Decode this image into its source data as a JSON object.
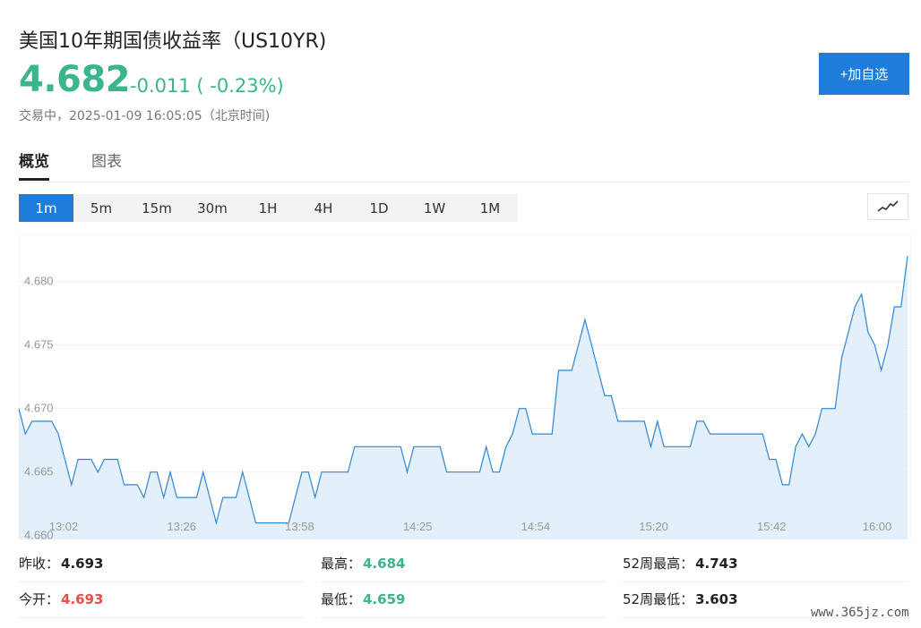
{
  "header": {
    "title": "美国10年期国债收益率（US10YR)",
    "price": "4.682",
    "change": "-0.011 ( -0.23%)",
    "status": "交易中，2025-01-09 16:05:05（北京时间)",
    "add_button": "+加自选"
  },
  "tabs": [
    {
      "label": "概览",
      "active": true
    },
    {
      "label": "图表",
      "active": false
    }
  ],
  "periods": [
    "1m",
    "5m",
    "15m",
    "30m",
    "1H",
    "4H",
    "1D",
    "1W",
    "1M"
  ],
  "active_period": "1m",
  "chart_type_icon": "line-chart-icon",
  "colors": {
    "line": "#2f86d6",
    "fill": "#e3effa",
    "down": "#3bb58e",
    "up": "#ee4b4b",
    "accent": "#1e7ddb"
  },
  "chart_data": {
    "type": "area",
    "x_ticks": [
      "13:02",
      "13:26",
      "13:58",
      "14:25",
      "14:54",
      "15:20",
      "15:42",
      "16:00"
    ],
    "y_ticks": [
      "4.660",
      "4.665",
      "4.670",
      "4.675",
      "4.680"
    ],
    "ylim": [
      4.6597,
      4.6837
    ],
    "grid": true,
    "legend": "none",
    "values": [
      4.67,
      4.668,
      4.669,
      4.669,
      4.669,
      4.669,
      4.668,
      4.666,
      4.664,
      4.666,
      4.666,
      4.666,
      4.665,
      4.666,
      4.666,
      4.666,
      4.664,
      4.664,
      4.664,
      4.663,
      4.665,
      4.665,
      4.663,
      4.665,
      4.663,
      4.663,
      4.663,
      4.663,
      4.665,
      4.663,
      4.661,
      4.663,
      4.663,
      4.663,
      4.665,
      4.663,
      4.661,
      4.661,
      4.661,
      4.661,
      4.661,
      4.661,
      4.663,
      4.665,
      4.665,
      4.663,
      4.665,
      4.665,
      4.665,
      4.665,
      4.665,
      4.667,
      4.667,
      4.667,
      4.667,
      4.667,
      4.667,
      4.667,
      4.667,
      4.665,
      4.667,
      4.667,
      4.667,
      4.667,
      4.667,
      4.665,
      4.665,
      4.665,
      4.665,
      4.665,
      4.665,
      4.667,
      4.665,
      4.665,
      4.667,
      4.668,
      4.67,
      4.67,
      4.668,
      4.668,
      4.668,
      4.668,
      4.673,
      4.673,
      4.673,
      4.675,
      4.677,
      4.675,
      4.673,
      4.671,
      4.671,
      4.669,
      4.669,
      4.669,
      4.669,
      4.669,
      4.667,
      4.669,
      4.667,
      4.667,
      4.667,
      4.667,
      4.667,
      4.669,
      4.669,
      4.668,
      4.668,
      4.668,
      4.668,
      4.668,
      4.668,
      4.668,
      4.668,
      4.668,
      4.666,
      4.666,
      4.664,
      4.664,
      4.667,
      4.668,
      4.667,
      4.668,
      4.67,
      4.67,
      4.67,
      4.674,
      4.676,
      4.678,
      4.679,
      4.676,
      4.675,
      4.673,
      4.675,
      4.678,
      4.678,
      4.682
    ]
  },
  "stats": [
    {
      "label": "昨收：",
      "value": "4.693",
      "tone": "flat"
    },
    {
      "label": "最高：",
      "value": "4.684",
      "tone": "down"
    },
    {
      "label": "52周最高：",
      "value": "4.743",
      "tone": "flat"
    },
    {
      "label": "今开：",
      "value": "4.693",
      "tone": "up"
    },
    {
      "label": "最低：",
      "value": "4.659",
      "tone": "down"
    },
    {
      "label": "52周最低：",
      "value": "3.603",
      "tone": "flat"
    }
  ],
  "watermark": "www.365jz.com"
}
